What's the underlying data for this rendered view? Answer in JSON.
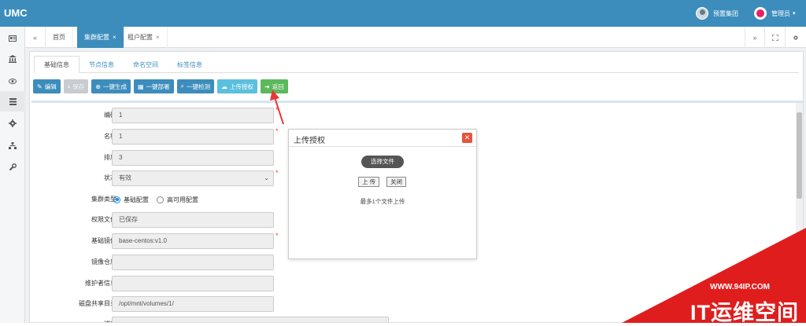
{
  "app": {
    "logo": "UMC"
  },
  "header": {
    "org_label": "预置集团",
    "user_label": "管理员",
    "user_caret": "▾"
  },
  "sidebar_icons": [
    "id-card-icon",
    "bank-icon",
    "eye-icon",
    "list-icon",
    "gear-icon",
    "sitemap-icon",
    "wrench-icon"
  ],
  "tabs": {
    "back_glyph": "«",
    "forward_glyph": "»",
    "items": [
      {
        "label": "首页",
        "active": false,
        "closable": false
      },
      {
        "label": "集群配置",
        "active": true,
        "closable": true
      },
      {
        "label": "租户配置",
        "active": false,
        "closable": true
      }
    ],
    "close_glyph": "×"
  },
  "subtabs": [
    "基础信息",
    "节点信息",
    "命名空间",
    "标签信息"
  ],
  "toolbar": {
    "edit": "编辑",
    "save": "保存",
    "generate": "一键生成",
    "deploy": "一键部署",
    "check": "一键检测",
    "upload_auth": "上传授权",
    "back": "返回"
  },
  "form": {
    "code": {
      "label": "编码",
      "value": "1"
    },
    "name": {
      "label": "名称",
      "value": "1"
    },
    "sort": {
      "label": "排序",
      "value": "3"
    },
    "status": {
      "label": "状态",
      "value": "有效"
    },
    "cluster_type": {
      "label": "集群类型",
      "option1": "基础配置",
      "option2": "高可用配置"
    },
    "license_file": {
      "label": "权限文件",
      "value": "已保存"
    },
    "base_image": {
      "label": "基础镜像",
      "value": "base-centos:v1.0"
    },
    "image_repo": {
      "label": "镜像仓库",
      "value": ""
    },
    "maintainer": {
      "label": "维护者信息",
      "value": ""
    },
    "disk_share": {
      "label": "磁盘共享目录",
      "value": "/opt/mnt/volumes/1/"
    },
    "description": {
      "label": "描述"
    }
  },
  "dialog": {
    "title": "上传授权",
    "choose_file": "选择文件",
    "upload": "上 传",
    "close": "关闭",
    "hint": "最多1个文件上传"
  },
  "watermark": {
    "url": "WWW.94IP.COM",
    "brand": "IT运维空间"
  },
  "colors": {
    "primary": "#3c8dbc",
    "info": "#5bc0de",
    "success": "#5cb85c",
    "required": "#e74c3c",
    "watermark": "#e01d1d"
  }
}
